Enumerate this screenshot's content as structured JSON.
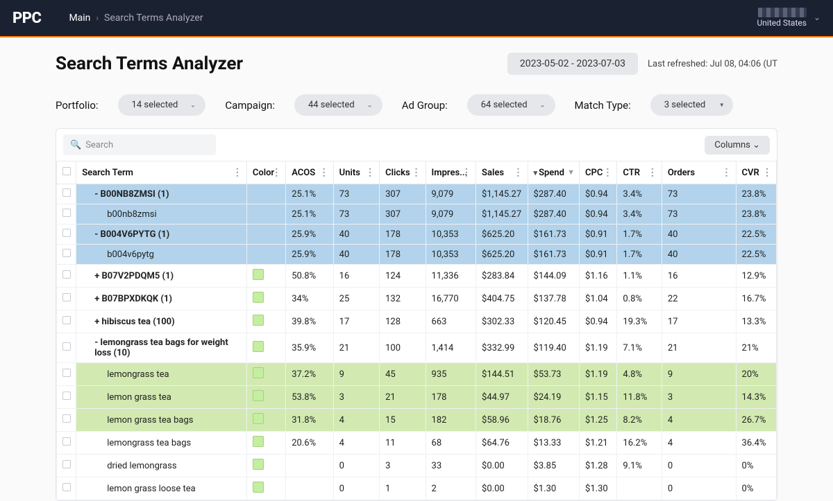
{
  "header": {
    "logo": "PPC",
    "crumb_root": "Main",
    "crumb_sep": "›",
    "crumb_page": "Search Terms Analyzer",
    "account_region": "United States"
  },
  "page": {
    "title": "Search Terms Analyzer",
    "date_range": "2023-05-02 - 2023-07-03",
    "last_refreshed": "Last refreshed: Jul 08, 04:06 (UT"
  },
  "filters": {
    "portfolio_label": "Portfolio:",
    "portfolio_value": "14 selected",
    "campaign_label": "Campaign:",
    "campaign_value": "44 selected",
    "adgroup_label": "Ad Group:",
    "adgroup_value": "64 selected",
    "matchtype_label": "Match Type:",
    "matchtype_value": "3 selected"
  },
  "table_bar": {
    "search_placeholder": "Search",
    "columns_label": "Columns"
  },
  "columns": {
    "term": "Search Term",
    "color": "Color",
    "acos": "ACOS",
    "units": "Units",
    "clicks": "Clicks",
    "impr": "Impres...",
    "sales": "Sales",
    "spend": "Spend",
    "cpc": "CPC",
    "ctr": "CTR",
    "orders": "Orders",
    "cvr": "CVR"
  },
  "rows": [
    {
      "term": "- B00NB8ZMSI (1)",
      "indent": 1,
      "color": "",
      "acos": "25.1%",
      "units": "73",
      "clicks": "307",
      "impr": "9,079",
      "sales": "$1,145.27",
      "spend": "$287.40",
      "cpc": "$0.94",
      "ctr": "3.4%",
      "orders": "73",
      "cvr": "23.8%",
      "rowclass": "row-blue"
    },
    {
      "term": "b00nb8zmsi",
      "indent": 2,
      "color": "",
      "acos": "25.1%",
      "units": "73",
      "clicks": "307",
      "impr": "9,079",
      "sales": "$1,145.27",
      "spend": "$287.40",
      "cpc": "$0.94",
      "ctr": "3.4%",
      "orders": "73",
      "cvr": "23.8%",
      "rowclass": "row-blue"
    },
    {
      "term": "- B004V6PYTG (1)",
      "indent": 1,
      "color": "",
      "acos": "25.9%",
      "units": "40",
      "clicks": "178",
      "impr": "10,353",
      "sales": "$625.20",
      "spend": "$161.73",
      "cpc": "$0.91",
      "ctr": "1.7%",
      "orders": "40",
      "cvr": "22.5%",
      "rowclass": "row-blue"
    },
    {
      "term": "b004v6pytg",
      "indent": 2,
      "color": "",
      "acos": "25.9%",
      "units": "40",
      "clicks": "178",
      "impr": "10,353",
      "sales": "$625.20",
      "spend": "$161.73",
      "cpc": "$0.91",
      "ctr": "1.7%",
      "orders": "40",
      "cvr": "22.5%",
      "rowclass": "row-blue"
    },
    {
      "term": "+ B07V2PDQM5 (1)",
      "indent": 1,
      "color": "sw",
      "acos": "50.8%",
      "units": "16",
      "clicks": "124",
      "impr": "11,336",
      "sales": "$283.84",
      "spend": "$144.09",
      "cpc": "$1.16",
      "ctr": "1.1%",
      "orders": "16",
      "cvr": "12.9%",
      "rowclass": ""
    },
    {
      "term": "+ B07BPXDKQK (1)",
      "indent": 1,
      "color": "sw",
      "acos": "34%",
      "units": "25",
      "clicks": "132",
      "impr": "16,770",
      "sales": "$404.75",
      "spend": "$137.78",
      "cpc": "$1.04",
      "ctr": "0.8%",
      "orders": "22",
      "cvr": "16.7%",
      "rowclass": ""
    },
    {
      "term": "+ hibiscus tea (100)",
      "indent": 1,
      "color": "sw",
      "acos": "39.8%",
      "units": "17",
      "clicks": "128",
      "impr": "663",
      "sales": "$302.33",
      "spend": "$120.45",
      "cpc": "$0.94",
      "ctr": "19.3%",
      "orders": "17",
      "cvr": "13.3%",
      "rowclass": ""
    },
    {
      "term": "- lemongrass tea bags for weight loss (10)",
      "indent": 1,
      "color": "sw",
      "acos": "35.9%",
      "units": "21",
      "clicks": "100",
      "impr": "1,414",
      "sales": "$332.99",
      "spend": "$119.40",
      "cpc": "$1.19",
      "ctr": "7.1%",
      "orders": "21",
      "cvr": "21%",
      "rowclass": ""
    },
    {
      "term": "lemongrass tea",
      "indent": 2,
      "color": "sw",
      "acos": "37.2%",
      "units": "9",
      "clicks": "45",
      "impr": "935",
      "sales": "$144.51",
      "spend": "$53.73",
      "cpc": "$1.19",
      "ctr": "4.8%",
      "orders": "9",
      "cvr": "20%",
      "rowclass": "row-green"
    },
    {
      "term": "lemon grass tea",
      "indent": 2,
      "color": "sw",
      "acos": "53.8%",
      "units": "3",
      "clicks": "21",
      "impr": "178",
      "sales": "$44.97",
      "spend": "$24.19",
      "cpc": "$1.15",
      "ctr": "11.8%",
      "orders": "3",
      "cvr": "14.3%",
      "rowclass": "row-green"
    },
    {
      "term": "lemon grass tea bags",
      "indent": 2,
      "color": "sw",
      "acos": "31.8%",
      "units": "4",
      "clicks": "15",
      "impr": "182",
      "sales": "$58.96",
      "spend": "$18.76",
      "cpc": "$1.25",
      "ctr": "8.2%",
      "orders": "4",
      "cvr": "26.7%",
      "rowclass": "row-green"
    },
    {
      "term": "lemongrass tea bags",
      "indent": 2,
      "color": "sw",
      "acos": "20.6%",
      "units": "4",
      "clicks": "11",
      "impr": "68",
      "sales": "$64.76",
      "spend": "$13.33",
      "cpc": "$1.21",
      "ctr": "16.2%",
      "orders": "4",
      "cvr": "36.4%",
      "rowclass": ""
    },
    {
      "term": "dried lemongrass",
      "indent": 2,
      "color": "sw",
      "acos": "",
      "units": "0",
      "clicks": "3",
      "impr": "33",
      "sales": "$0.00",
      "spend": "$3.85",
      "cpc": "$1.28",
      "ctr": "9.1%",
      "orders": "0",
      "cvr": "0%",
      "rowclass": ""
    },
    {
      "term": "lemon grass loose tea",
      "indent": 2,
      "color": "sw",
      "acos": "",
      "units": "0",
      "clicks": "1",
      "impr": "2",
      "sales": "$0.00",
      "spend": "$1.30",
      "cpc": "$1.30",
      "ctr": "",
      "orders": "0",
      "cvr": "0%",
      "rowclass": ""
    }
  ]
}
